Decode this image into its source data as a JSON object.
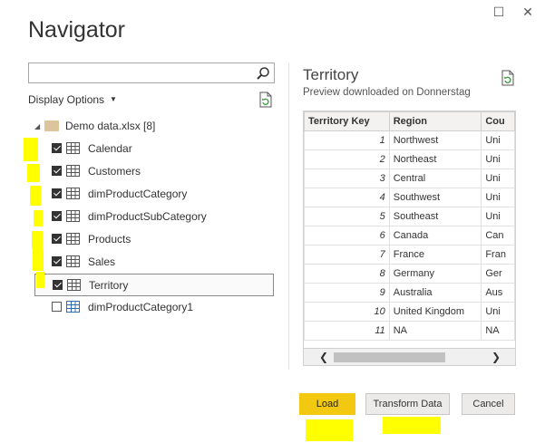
{
  "window": {
    "maximize_glyph": "☐",
    "close_glyph": "✕"
  },
  "dialog": {
    "title": "Navigator"
  },
  "left": {
    "search": {
      "value": "",
      "placeholder": ""
    },
    "display_options_label": "Display Options",
    "tree": {
      "root_label": "Demo data.xlsx [8]",
      "items": [
        {
          "label": "Calendar",
          "checked": true
        },
        {
          "label": "Customers",
          "checked": true
        },
        {
          "label": "dimProductCategory",
          "checked": true
        },
        {
          "label": "dimProductSubCategory",
          "checked": true
        },
        {
          "label": "Products",
          "checked": true
        },
        {
          "label": "Sales",
          "checked": true
        },
        {
          "label": "Territory",
          "checked": true,
          "selected": true
        },
        {
          "label": "dimProductCategory1",
          "checked": false
        }
      ]
    }
  },
  "preview": {
    "title": "Territory",
    "subtitle": "Preview downloaded on Donnerstag",
    "columns": [
      "Territory Key",
      "Region",
      "Cou"
    ],
    "rows": [
      [
        "1",
        "Northwest",
        "Uni"
      ],
      [
        "2",
        "Northeast",
        "Uni"
      ],
      [
        "3",
        "Central",
        "Uni"
      ],
      [
        "4",
        "Southwest",
        "Uni"
      ],
      [
        "5",
        "Southeast",
        "Uni"
      ],
      [
        "6",
        "Canada",
        "Can"
      ],
      [
        "7",
        "France",
        "Fran"
      ],
      [
        "8",
        "Germany",
        "Ger"
      ],
      [
        "9",
        "Australia",
        "Aus"
      ],
      [
        "10",
        "United Kingdom",
        "Uni"
      ],
      [
        "11",
        "NA",
        "NA"
      ]
    ]
  },
  "buttons": {
    "load": "Load",
    "transform": "Transform Data",
    "cancel": "Cancel"
  },
  "colors": {
    "load_button": "#f2c811",
    "annotation_highlight": "#ffff00"
  },
  "icons": {
    "search": "search-icon",
    "refresh": "refresh-icon",
    "folder": "folder-icon",
    "table": "table-icon"
  }
}
